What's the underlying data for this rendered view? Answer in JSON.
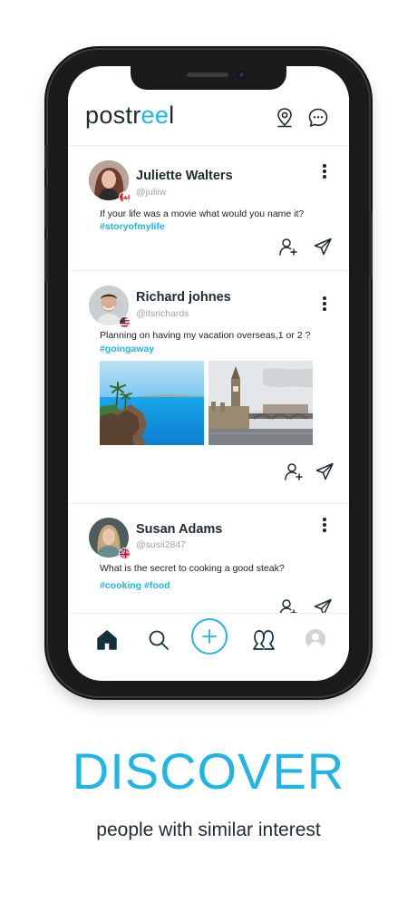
{
  "app": {
    "logo_prefix": "postr",
    "logo_accent": "ee",
    "logo_suffix": "l",
    "brand_color": "#1fb6e6",
    "header_icons": [
      "location-pin-icon",
      "chat-bubble-icon"
    ]
  },
  "posts": [
    {
      "name": "Juliette Walters",
      "handle": "@juliiw",
      "flag": "canada",
      "text": "If your life was a movie what would you name it?",
      "tags": "#storyofmylife",
      "images": []
    },
    {
      "name": "Richard johnes",
      "handle": "@itsrichards",
      "flag": "usa",
      "text": "Planning on having my vacation overseas,1 or 2 ?",
      "tags": "#goingaway",
      "images": [
        "tropical-cliff-ocean-photo",
        "london-big-ben-photo"
      ]
    },
    {
      "name": "Susan Adams",
      "handle": "@susii2847",
      "flag": "uk",
      "text": "What is the secret to cooking a good steak?",
      "tags": "#cooking #food",
      "images": []
    }
  ],
  "tabbar": {
    "items": [
      "home-icon",
      "search-icon",
      "add-post-icon",
      "people-icon",
      "profile-icon"
    ],
    "active": "home-icon"
  },
  "marketing": {
    "headline": "DISCOVER",
    "subline": "people with similar interest"
  }
}
